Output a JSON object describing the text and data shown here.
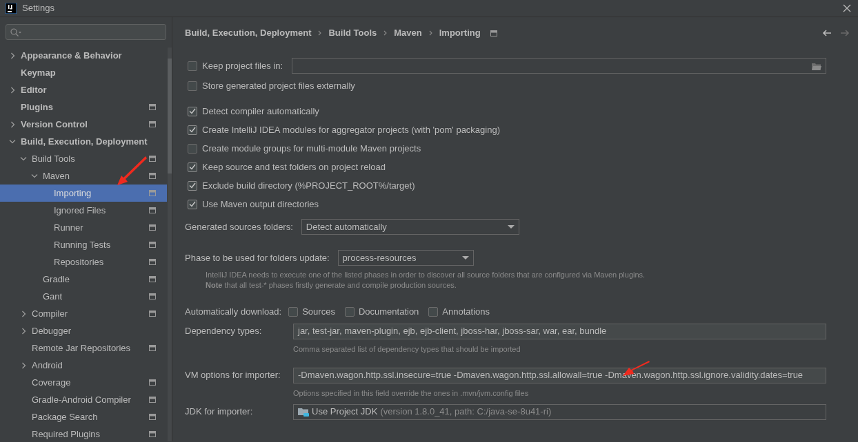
{
  "window": {
    "title": "Settings"
  },
  "sidebar": {
    "items": [
      {
        "label": "Appearance & Behavior",
        "expanded": false,
        "selected": false,
        "project_icon": false
      },
      {
        "label": "Keymap",
        "selected": false,
        "project_icon": false
      },
      {
        "label": "Editor",
        "expanded": false,
        "selected": false,
        "project_icon": false
      },
      {
        "label": "Plugins",
        "selected": false,
        "project_icon": true
      },
      {
        "label": "Version Control",
        "expanded": false,
        "selected": false,
        "project_icon": true
      },
      {
        "label": "Build, Execution, Deployment",
        "expanded": true,
        "selected": false,
        "project_icon": false,
        "children": [
          {
            "label": "Build Tools",
            "expanded": true,
            "selected": false,
            "project_icon": true,
            "children": [
              {
                "label": "Maven",
                "expanded": true,
                "selected": false,
                "project_icon": true,
                "children": [
                  {
                    "label": "Importing",
                    "selected": true,
                    "project_icon": true
                  },
                  {
                    "label": "Ignored Files",
                    "selected": false,
                    "project_icon": true
                  },
                  {
                    "label": "Runner",
                    "selected": false,
                    "project_icon": true
                  },
                  {
                    "label": "Running Tests",
                    "selected": false,
                    "project_icon": true
                  },
                  {
                    "label": "Repositories",
                    "selected": false,
                    "project_icon": true
                  }
                ]
              },
              {
                "label": "Gradle",
                "selected": false,
                "project_icon": true
              },
              {
                "label": "Gant",
                "selected": false,
                "project_icon": true
              }
            ]
          },
          {
            "label": "Compiler",
            "expanded": false,
            "selected": false,
            "project_icon": true
          },
          {
            "label": "Debugger",
            "expanded": false,
            "selected": false,
            "project_icon": false
          },
          {
            "label": "Remote Jar Repositories",
            "selected": false,
            "project_icon": true
          },
          {
            "label": "Android",
            "expanded": false,
            "selected": false,
            "project_icon": false
          },
          {
            "label": "Coverage",
            "selected": false,
            "project_icon": true
          },
          {
            "label": "Gradle-Android Compiler",
            "selected": false,
            "project_icon": true
          },
          {
            "label": "Package Search",
            "selected": false,
            "project_icon": true
          },
          {
            "label": "Required Plugins",
            "selected": false,
            "project_icon": true
          }
        ]
      }
    ]
  },
  "breadcrumb": [
    "Build, Execution, Deployment",
    "Build Tools",
    "Maven",
    "Importing"
  ],
  "navigation": {
    "back_enabled": true,
    "forward_enabled": false
  },
  "option_groups": [
    [
      {
        "kind": "path",
        "label": "Keep project files in:",
        "checked": false
      },
      {
        "kind": "checkbox",
        "label": "Store generated project files externally",
        "checked": false
      }
    ],
    [
      {
        "kind": "checkbox",
        "label": "Detect compiler automatically",
        "checked": true
      },
      {
        "kind": "checkbox",
        "label": "Create IntelliJ IDEA modules for aggregator projects (with 'pom' packaging)",
        "checked": true
      },
      {
        "kind": "checkbox",
        "label": "Create module groups for multi-module Maven projects",
        "checked": false
      },
      {
        "kind": "checkbox",
        "label": "Keep source and test folders on project reload",
        "checked": true
      },
      {
        "kind": "checkbox",
        "label": "Exclude build directory (%PROJECT_ROOT%/target)",
        "checked": true
      },
      {
        "kind": "checkbox",
        "label": "Use Maven output directories",
        "checked": true
      }
    ]
  ],
  "generated_sources": {
    "label": "Generated sources folders:",
    "value": "Detect automatically"
  },
  "phase": {
    "label": "Phase to be used for folders update:",
    "value": "process-resources",
    "hint": [
      "IntelliJ IDEA needs to execute one of the listed phases in order to discover all source folders that are configured via Maven plugins.",
      "**Note** that all test-* phases firstly generate and compile production sources."
    ]
  },
  "auto_download": {
    "label": "Automatically download:",
    "options": [
      {
        "label": "Sources",
        "checked": false
      },
      {
        "label": "Documentation",
        "checked": false
      },
      {
        "label": "Annotations",
        "checked": false
      }
    ]
  },
  "dependency_types": {
    "label": "Dependency types:",
    "value": "jar, test-jar, maven-plugin, ejb, ejb-client, jboss-har, jboss-sar, war, ear, bundle",
    "hint": "Comma separated list of dependency types that should be imported"
  },
  "vm_options": {
    "label": "VM options for importer:",
    "value": "-Dmaven.wagon.http.ssl.insecure=true -Dmaven.wagon.http.ssl.allowall=true -Dmaven.wagon.http.ssl.ignore.validity.dates=true",
    "hint": "Options specified in this field override the ones in .mvn/jvm.config files"
  },
  "jdk": {
    "label": "JDK for importer:",
    "value": "Use Project JDK",
    "detail": "(version 1.8.0_41, path: C:/java-se-8u41-ri)"
  }
}
